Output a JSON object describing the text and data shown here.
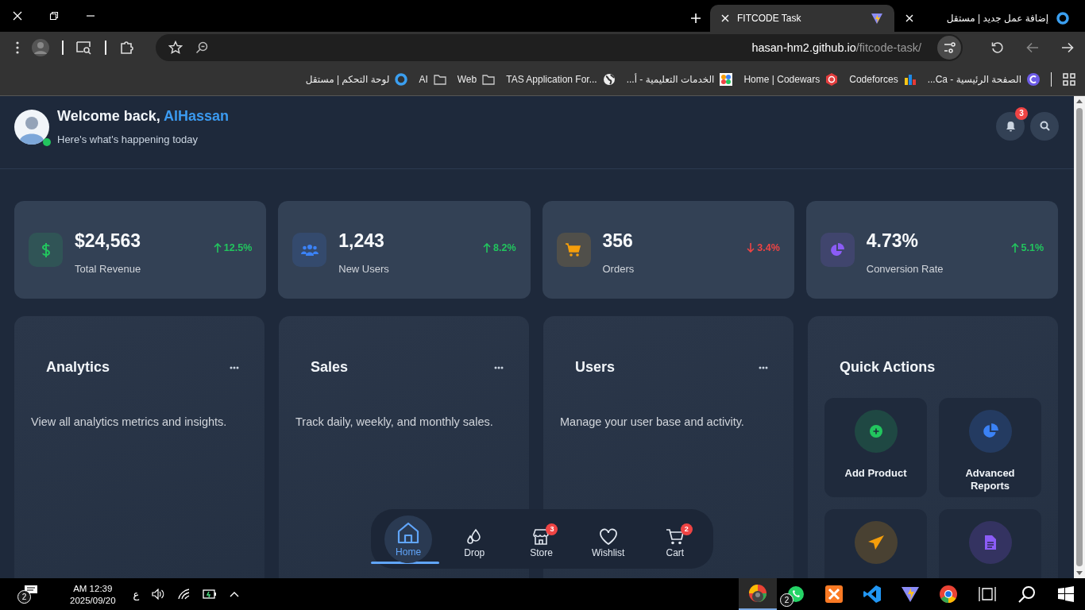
{
  "browser": {
    "tabs": [
      {
        "title": "FITCODE Task",
        "selected": true,
        "kind": "vite"
      },
      {
        "title": "إضافة عمل جديد | مستقل",
        "selected": false,
        "kind": "ring"
      }
    ],
    "url": {
      "host": "hasan-hm2.github.io",
      "path": "/fitcode-task/"
    },
    "bookmarks": [
      {
        "label": "لوحة التحكم | مستقل",
        "kind": "ring"
      },
      {
        "label": "AI",
        "kind": "folder"
      },
      {
        "label": "Web",
        "kind": "folder"
      },
      {
        "label": "TAS Application For...",
        "kind": "globe"
      },
      {
        "label": "الخدمات التعليمية - أ...",
        "kind": "tile"
      },
      {
        "label": "Home | Codewars",
        "kind": "hex"
      },
      {
        "label": "Codeforces",
        "kind": "bars"
      },
      {
        "label": "الصفحة الرئيسية - Ca...",
        "kind": "c"
      }
    ]
  },
  "header": {
    "greeting": "Welcome back,",
    "name": "AlHassan",
    "subtitle": "Here's what's happening today",
    "online": true,
    "notifications": "3"
  },
  "stats": [
    {
      "value": "$24,563",
      "label": "Total Revenue",
      "change": "12.5%",
      "down": false,
      "kind": "dollar",
      "color": "#22c55e"
    },
    {
      "value": "1,243",
      "label": "New Users",
      "change": "8.2%",
      "down": false,
      "kind": "users",
      "color": "#3b82f6"
    },
    {
      "value": "356",
      "label": "Orders",
      "change": "3.4%",
      "down": true,
      "kind": "cart",
      "color": "#f59e0b"
    },
    {
      "value": "4.73%",
      "label": "Conversion Rate",
      "change": "5.1%",
      "down": false,
      "kind": "pie",
      "color": "#8b5cf6"
    }
  ],
  "cards": [
    {
      "title": "Analytics",
      "text": "View all analytics metrics and insights."
    },
    {
      "title": "Sales",
      "text": "Track daily, weekly, and monthly sales."
    },
    {
      "title": "Users",
      "text": "Manage your user base and activity."
    }
  ],
  "quick_actions": {
    "title": "Quick Actions",
    "items": [
      {
        "label": "Add Product",
        "kind": "plus",
        "color": "#22c55e"
      },
      {
        "label": "Advanced Reports",
        "kind": "pie",
        "color": "#3b82f6"
      },
      {
        "kind": "send",
        "color": "#f59e0b"
      },
      {
        "kind": "doc",
        "color": "#8b5cf6"
      }
    ]
  },
  "bottom_nav": [
    {
      "label": "Home",
      "kind": "home",
      "selected": true
    },
    {
      "label": "Drop",
      "kind": "drop",
      "selected": false
    },
    {
      "label": "Store",
      "kind": "store",
      "selected": false,
      "badge": "3"
    },
    {
      "label": "Wishlist",
      "kind": "heart",
      "selected": false
    },
    {
      "label": "Cart",
      "kind": "cart",
      "selected": false,
      "badge": "2"
    }
  ],
  "taskbar": {
    "notifications": "2",
    "time": "AM 12:39",
    "date": "2025/09/20",
    "language": "ع",
    "apps": [
      {
        "kind": "profile",
        "selected": true
      },
      {
        "kind": "whatsapp",
        "selected": false,
        "badge": "2"
      },
      {
        "kind": "xampp",
        "selected": false
      },
      {
        "kind": "vscode",
        "selected": false
      },
      {
        "kind": "vite",
        "selected": false
      },
      {
        "kind": "chrome",
        "selected": false
      }
    ]
  }
}
